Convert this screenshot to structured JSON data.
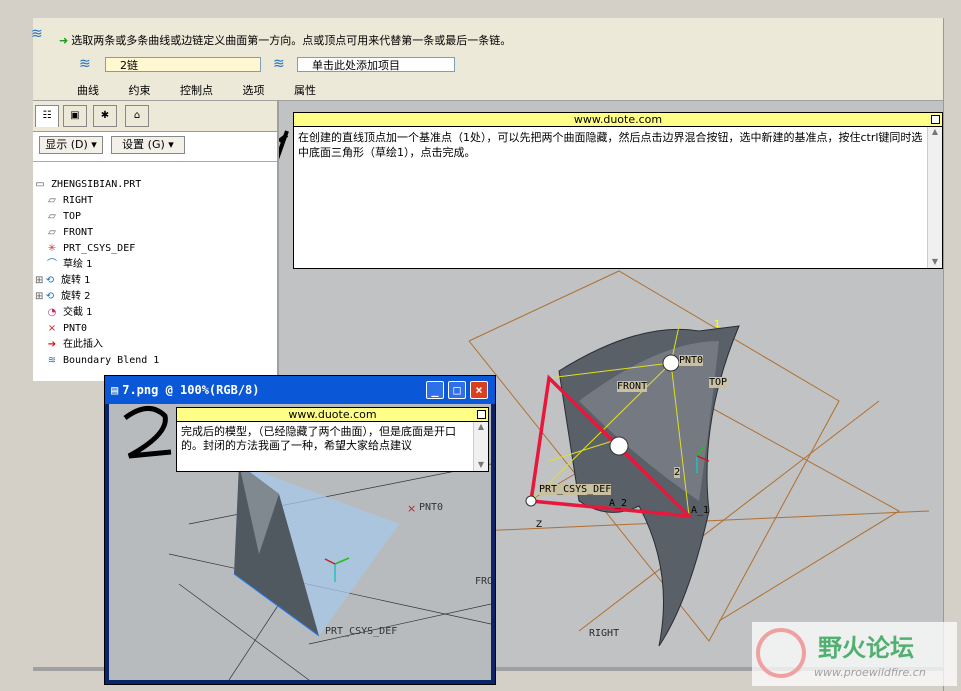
{
  "dashboard": {
    "prompt": "选取两条或多条曲线或边链定义曲面第一方向。点或顶点可用来代替第一条或最后一条链。",
    "chain_field": "2链",
    "add_item_field": "单击此处添加项目",
    "tabs": [
      "曲线",
      "约束",
      "控制点",
      "选项",
      "属性"
    ]
  },
  "tree": {
    "show_button": "显示 (D)",
    "settings_button": "设置 (G)",
    "items": [
      {
        "icon": "part-icon",
        "label": "ZHENGSIBIAN.PRT"
      },
      {
        "icon": "datum-plane-icon",
        "label": "RIGHT"
      },
      {
        "icon": "datum-plane-icon",
        "label": "TOP"
      },
      {
        "icon": "datum-plane-icon",
        "label": "FRONT"
      },
      {
        "icon": "csys-icon",
        "label": "PRT_CSYS_DEF"
      },
      {
        "icon": "sketch-icon",
        "label": "草绘 1"
      },
      {
        "icon": "revolve-icon",
        "label": "旋转 1"
      },
      {
        "icon": "revolve-icon",
        "label": "旋转 2"
      },
      {
        "icon": "intersect-icon",
        "label": "交截 1"
      },
      {
        "icon": "datum-point-icon",
        "label": "PNT0"
      },
      {
        "icon": "insert-here-icon",
        "label": "在此插入"
      },
      {
        "icon": "boundary-blend-icon",
        "label": "Boundary Blend 1"
      }
    ]
  },
  "note1": {
    "title": "www.duote.com",
    "text": "在创建的直线顶点加一个基准点（1处），可以先把两个曲面隐藏，然后点击边界混合按钮，选中新建的基准点，按住ctrl键同时选中底面三角形（草绘1），点击完成。"
  },
  "note2": {
    "title": "www.duote.com",
    "text": "完成后的模型，（已经隐藏了两个曲面），但是底面是开口的。封闭的方法我画了一种，希望大家给点建议"
  },
  "image_window": {
    "title": "7.png @ 100%(RGB/8)"
  },
  "model_labels": {
    "pnt0": "PNT0",
    "front": "FRONT",
    "top": "TOP",
    "csys": "PRT_CSYS_DEF",
    "right": "RIGHT",
    "a2": "A_2",
    "a1": "A_1",
    "num1": "1",
    "num2": "2",
    "z": "Z"
  },
  "inner_labels": {
    "pnt0": "PNT0",
    "csys": "PRT_CSYS_DEF",
    "fro": "FRO"
  },
  "annotations": {
    "one": "1",
    "two": "2"
  },
  "watermark": {
    "title": "野火论坛",
    "url": "www.proewildfire.cn"
  },
  "colors": {
    "accent_red": "#e8183c",
    "title_blue": "#0a58d8",
    "note_yellow": "#ffff88"
  }
}
